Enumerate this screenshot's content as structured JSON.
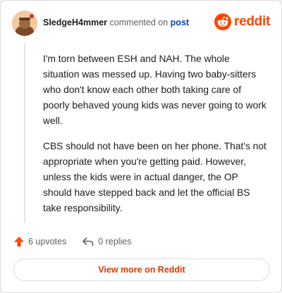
{
  "comment": {
    "username": "SledgeH4mmer",
    "commented_on_text": "commented on",
    "post_link_text": "post",
    "paragraphs": [
      "I'm torn between ESH and NAH. The whole situation was messed up. Having two baby-sitters who don't know each other both taking care of poorly behaved young kids was never going to work well.",
      "CBS should not have been on her phone. That's not appropriate when you're getting paid. However, unless the kids were in actual danger, the OP should have stepped back and let the official BS take responsibility."
    ]
  },
  "brand": {
    "name": "reddit",
    "icon": "reddit-logo-icon",
    "color": "#ff4500"
  },
  "actions": {
    "upvotes_label": "6 upvotes",
    "upvote_icon": "upvote-arrow-icon",
    "replies_label": "0 replies",
    "reply_icon": "reply-arrow-icon"
  },
  "footer": {
    "view_more_label": "View more on Reddit"
  },
  "colors": {
    "accent": "#ff4500",
    "link": "#0045ac",
    "button_text": "#d93a00"
  }
}
